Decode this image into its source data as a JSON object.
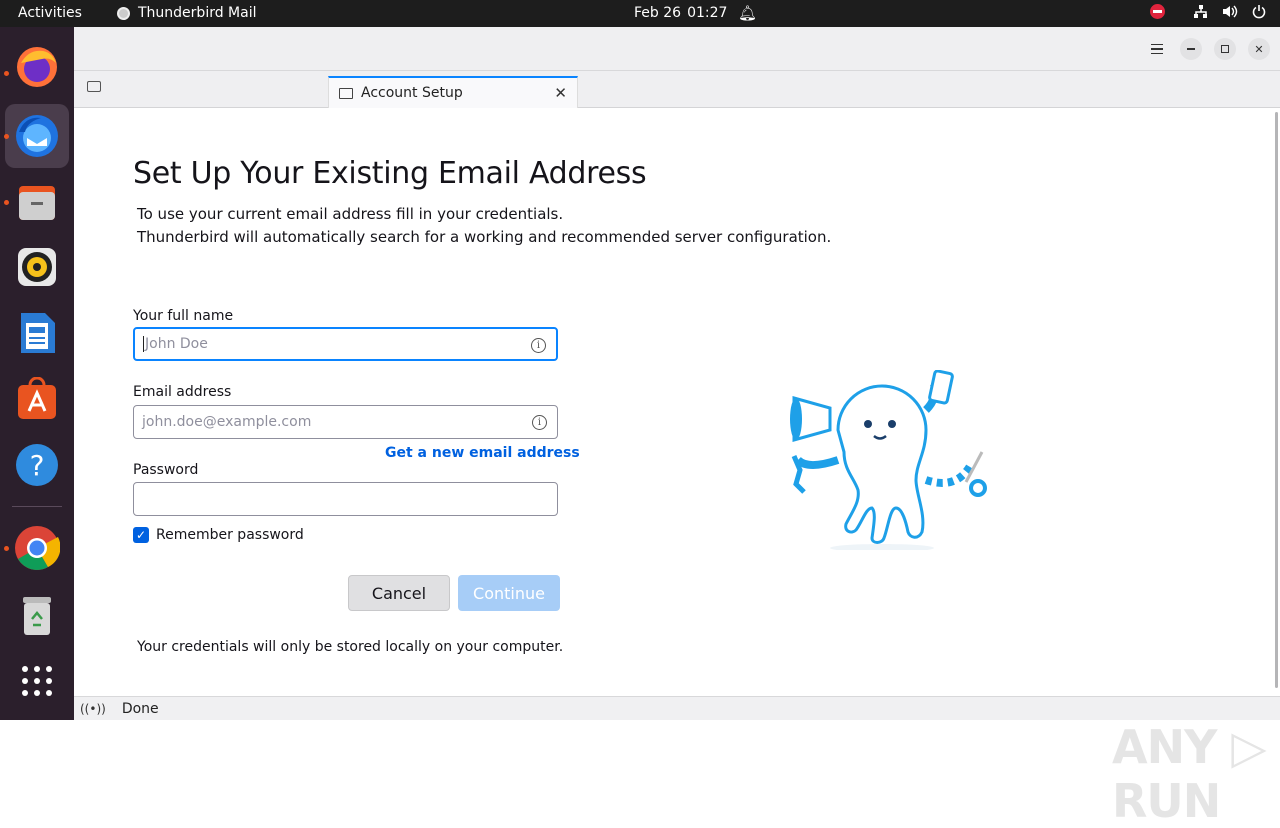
{
  "topbar": {
    "activities": "Activities",
    "app_name": "Thunderbird Mail",
    "date": "Feb 26",
    "time": "01:27"
  },
  "dock": {
    "items": [
      "firefox-icon",
      "thunderbird-icon",
      "files-icon",
      "rhythmbox-icon",
      "writer-icon",
      "app-center-icon",
      "help-icon",
      "chrome-icon",
      "trash-icon",
      "show-apps-icon"
    ]
  },
  "tabs": [
    {
      "label": "Account Setup"
    }
  ],
  "page": {
    "title": "Set Up Your Existing Email Address",
    "desc1": "To use your current email address fill in your credentials.",
    "desc2": "Thunderbird will automatically search for a working and recommended server configuration.",
    "name_label": "Your full name",
    "name_placeholder": "John Doe",
    "email_label": "Email address",
    "email_placeholder": "john.doe@example.com",
    "get_new_email": "Get a new email address",
    "password_label": "Password",
    "remember_label": "Remember password",
    "remember_checked": true,
    "cancel_label": "Cancel",
    "continue_label": "Continue",
    "note": "Your credentials will only be stored locally on your computer."
  },
  "status": {
    "text": "Done"
  },
  "colors": {
    "accent": "#0061e0",
    "focus": "#0a84ff",
    "continue_disabled": "#a7cdf7"
  }
}
